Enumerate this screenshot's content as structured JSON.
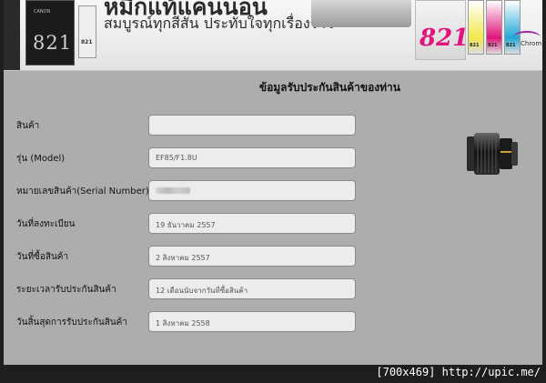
{
  "banner": {
    "headline": "หมึกแท้แคนนอน",
    "tagline": "สมบูรณ์ทุกสีสัน ประทับใจทุกเรื่องราว",
    "left_cartridge_code": "821",
    "left_cartridge_small": "821",
    "pack_code": "821",
    "cartridge_numbers": [
      "821",
      "821",
      "821"
    ],
    "brand_short": "Chrom"
  },
  "form": {
    "title": "ข้อมูลรับประกันสินค้าของท่าน",
    "fields": [
      {
        "label": "สินค้า",
        "value": ""
      },
      {
        "label": "รุ่น (Model)",
        "value": "EF85/F1.8U"
      },
      {
        "label": "หมายเลขสินค้า(Serial Number)",
        "value": ""
      },
      {
        "label": "วันที่ลงทะเบียน",
        "value": "19 ธันวาคม 2557"
      },
      {
        "label": "วันที่ซื้อสินค้า",
        "value": "2 สิงหาคม 2557"
      },
      {
        "label": "ระยะเวลารับประกันสินค้า",
        "value": "12 เดือนนับจากวันที่ซื้อสินค้า"
      },
      {
        "label": "วันสิ้นสุดการรับประกันสินค้า",
        "value": "1 สิงหาคม 2558"
      }
    ]
  },
  "watermark": "[700x469] http://upic.me/",
  "colors": {
    "panel": "#adadad",
    "frame": "#1e1e1e",
    "field_bg": "#ececec",
    "accent_magenta": "#e0147a"
  },
  "icons": {
    "product_image": "camera-lens"
  }
}
